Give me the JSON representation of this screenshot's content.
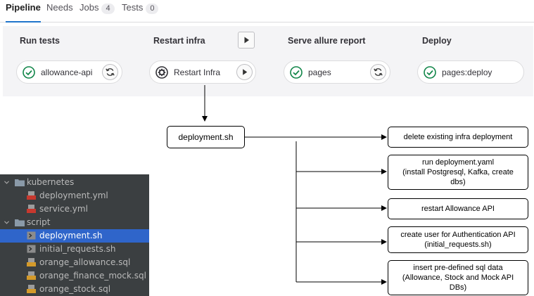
{
  "tabs": [
    {
      "label": "Pipeline",
      "badge": null,
      "active": true
    },
    {
      "label": "Needs",
      "badge": null,
      "active": false
    },
    {
      "label": "Jobs",
      "badge": "4",
      "active": false
    },
    {
      "label": "Tests",
      "badge": "0",
      "active": false
    }
  ],
  "stages": [
    {
      "title": "Run tests",
      "job": "allowance-api",
      "status": "success",
      "action": "retry"
    },
    {
      "title": "Restart infra",
      "job": "Restart Infra",
      "status": "manual",
      "action": "play"
    },
    {
      "title": "Serve allure report",
      "job": "pages",
      "status": "success",
      "action": "retry"
    },
    {
      "title": "Deploy",
      "job": "pages:deploy",
      "status": "success",
      "action": null
    }
  ],
  "colors": {
    "success": "#108548",
    "accent": "#1f75cb",
    "tree_bg": "#3b3f41",
    "tree_selected": "#2f65ca"
  },
  "flow": {
    "source": "deployment.sh",
    "steps": [
      "delete existing infra deployment",
      "run deployment.yaml\n(install Postgresql, Kafka, create\ndbs)",
      "restart Allowance API",
      "create user for Authentication API\n(initial_requests.sh)",
      "insert pre-defined sql data\n(Allowance, Stock and Mock API\nDBs)"
    ]
  },
  "tree": {
    "items": [
      {
        "label": "kubernetes",
        "kind": "folder",
        "depth": 0
      },
      {
        "label": "deployment.yml",
        "kind": "yml",
        "depth": 1
      },
      {
        "label": "service.yml",
        "kind": "yml",
        "depth": 1
      },
      {
        "label": "script",
        "kind": "folder",
        "depth": 0
      },
      {
        "label": "deployment.sh",
        "kind": "sh",
        "depth": 1,
        "selected": true
      },
      {
        "label": "initial_requests.sh",
        "kind": "sh",
        "depth": 1
      },
      {
        "label": "orange_allowance.sql",
        "kind": "sql",
        "depth": 1
      },
      {
        "label": "orange_finance_mock.sql",
        "kind": "sql",
        "depth": 1
      },
      {
        "label": "orange_stock.sql",
        "kind": "sql",
        "depth": 1
      }
    ]
  }
}
